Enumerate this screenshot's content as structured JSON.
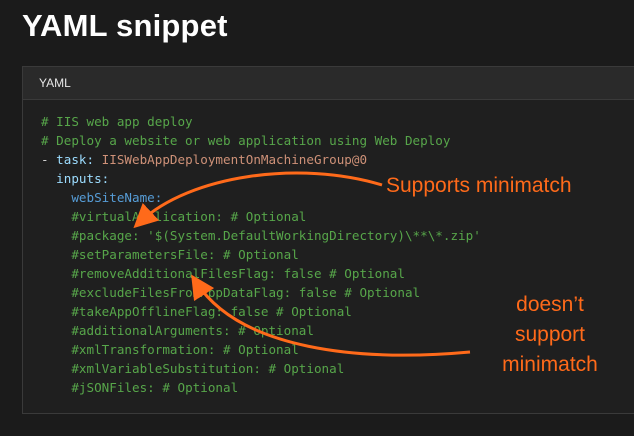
{
  "page": {
    "title": "YAML snippet"
  },
  "code_block": {
    "language": "YAML",
    "lines": [
      {
        "indent": "",
        "parts": [
          {
            "t": "# IIS web app deploy",
            "c": "comment"
          }
        ]
      },
      {
        "indent": "",
        "parts": [
          {
            "t": "# Deploy a website or web application using Web Deploy",
            "c": "comment"
          }
        ]
      },
      {
        "indent": "",
        "parts": [
          {
            "t": "- ",
            "c": "dash"
          },
          {
            "t": "task: ",
            "c": "key"
          },
          {
            "t": "IISWebAppDeploymentOnMachineGroup@0",
            "c": "val"
          }
        ]
      },
      {
        "indent": "  ",
        "parts": [
          {
            "t": "inputs:",
            "c": "key"
          }
        ]
      },
      {
        "indent": "    ",
        "parts": [
          {
            "t": "webSiteName:",
            "c": "keyb"
          }
        ]
      },
      {
        "indent": "    ",
        "parts": [
          {
            "t": "#virtualApplication: # Optional",
            "c": "comment"
          }
        ]
      },
      {
        "indent": "    ",
        "parts": [
          {
            "t": "#package: '$(System.DefaultWorkingDirectory)\\**\\*.zip'",
            "c": "comment"
          }
        ]
      },
      {
        "indent": "    ",
        "parts": [
          {
            "t": "#setParametersFile: # Optional",
            "c": "comment"
          }
        ]
      },
      {
        "indent": "    ",
        "parts": [
          {
            "t": "#removeAdditionalFilesFlag: false # Optional",
            "c": "comment"
          }
        ]
      },
      {
        "indent": "    ",
        "parts": [
          {
            "t": "#excludeFilesFromAppDataFlag: false # Optional",
            "c": "comment"
          }
        ]
      },
      {
        "indent": "    ",
        "parts": [
          {
            "t": "#takeAppOfflineFlag: false # Optional",
            "c": "comment"
          }
        ]
      },
      {
        "indent": "    ",
        "parts": [
          {
            "t": "#additionalArguments: # Optional",
            "c": "comment"
          }
        ]
      },
      {
        "indent": "    ",
        "parts": [
          {
            "t": "#xmlTransformation: # Optional",
            "c": "comment"
          }
        ]
      },
      {
        "indent": "    ",
        "parts": [
          {
            "t": "#xmlVariableSubstitution: # Optional",
            "c": "comment"
          }
        ]
      },
      {
        "indent": "    ",
        "parts": [
          {
            "t": "#jSONFiles: # Optional",
            "c": "comment"
          }
        ]
      }
    ]
  },
  "annotations": {
    "supports": "Supports minimatch",
    "not_supports_line1": "doesn’t",
    "not_supports_line2": "support",
    "not_supports_line3": "minimatch",
    "color": "#ff6a1a"
  },
  "colors": {
    "comment": "#57a64a",
    "key": "#9cdcfe",
    "value": "#ce9178",
    "background": "#1b1b1b"
  }
}
